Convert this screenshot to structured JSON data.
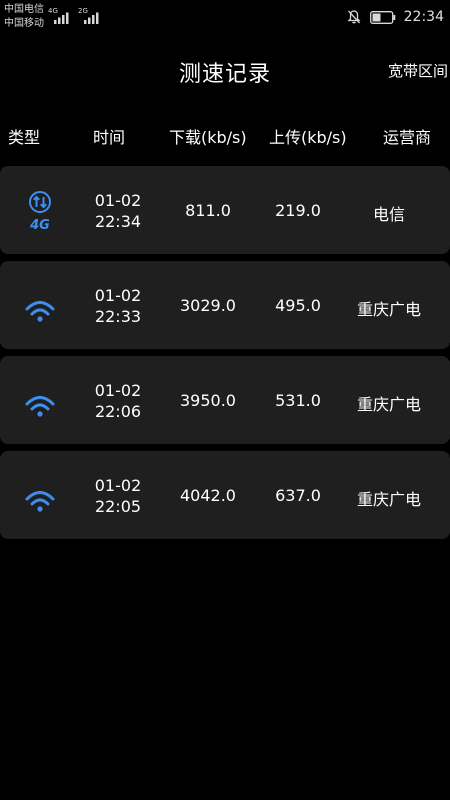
{
  "status_bar": {
    "carrier_1": "中国电信",
    "carrier_2": "中国移动",
    "signal_1_tech": "4G",
    "signal_2_tech": "2G",
    "time": "22:34",
    "icons": [
      "notifications-off-icon",
      "battery-icon"
    ]
  },
  "header": {
    "title": "测速记录",
    "action": "宽带区间"
  },
  "columns": [
    "类型",
    "时间",
    "下载(kb/s)",
    "上传(kb/s)",
    "运营商"
  ],
  "records": [
    {
      "type": "4g",
      "icon": "4g-network-icon",
      "icon_text": "4G",
      "date": "01-02",
      "time": "22:34",
      "download": "811.0",
      "upload": "219.0",
      "isp": "电信"
    },
    {
      "type": "wifi",
      "icon": "wifi-icon",
      "date": "01-02",
      "time": "22:33",
      "download": "3029.0",
      "upload": "495.0",
      "isp": "重庆广电"
    },
    {
      "type": "wifi",
      "icon": "wifi-icon",
      "date": "01-02",
      "time": "22:06",
      "download": "3950.0",
      "upload": "531.0",
      "isp": "重庆广电"
    },
    {
      "type": "wifi",
      "icon": "wifi-icon",
      "date": "01-02",
      "time": "22:05",
      "download": "4042.0",
      "upload": "637.0",
      "isp": "重庆广电"
    }
  ],
  "colors": {
    "background": "#000000",
    "card": "#1f1f1f",
    "icon_blue": "#3d8ef0",
    "text": "#ffffff"
  }
}
